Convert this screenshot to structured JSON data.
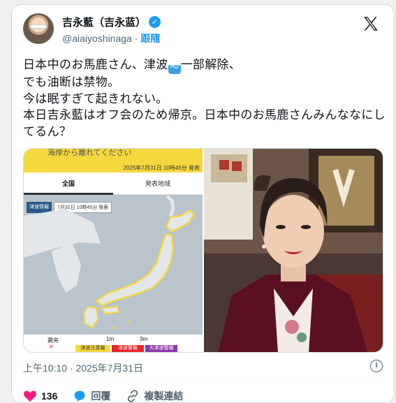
{
  "author": {
    "display_name": "吉永藍（吉永蓝）",
    "handle": "@aiaiyoshinaga",
    "separator": "·",
    "follow_label": "跟隨"
  },
  "tweet": {
    "line1_before": "日本中のお馬鹿さん、津波",
    "wave_icon": "wave-emoji",
    "line1_after": "一部解除、",
    "rest": "でも油断は禁物。\n今は眠すぎて起きれない。\n本日吉永藍はオフ会のため帰京。日本中のお馬鹿さんみんななにしてるん？"
  },
  "map_image": {
    "warning": "海岸から離れてください",
    "date": "2025年7月31日 10時45分 発表",
    "tab_all": "全国",
    "tab_region": "発表地域",
    "badge_dark": "津波情報",
    "badge_light": "7月31日 10時45分 発表",
    "legend_epicenter": "震央",
    "legend_1m": "1m",
    "legend_3m": "3m",
    "legend_advisory": "津波注意報",
    "legend_warning": "津波警報",
    "legend_major": "大津波警報",
    "colors": {
      "advisory": "#f5d83d",
      "warning": "#e8262d",
      "major": "#8b3aa8",
      "coast": "#f5d83d"
    }
  },
  "meta": {
    "timestamp": "上午10:10 · 2025年7月31日"
  },
  "actions": {
    "like_count": "136",
    "reply_label": "回覆",
    "copy_label": "複製連結"
  },
  "colors": {
    "accent": "#1d9bf0",
    "like": "#f91880",
    "muted": "#536471"
  }
}
